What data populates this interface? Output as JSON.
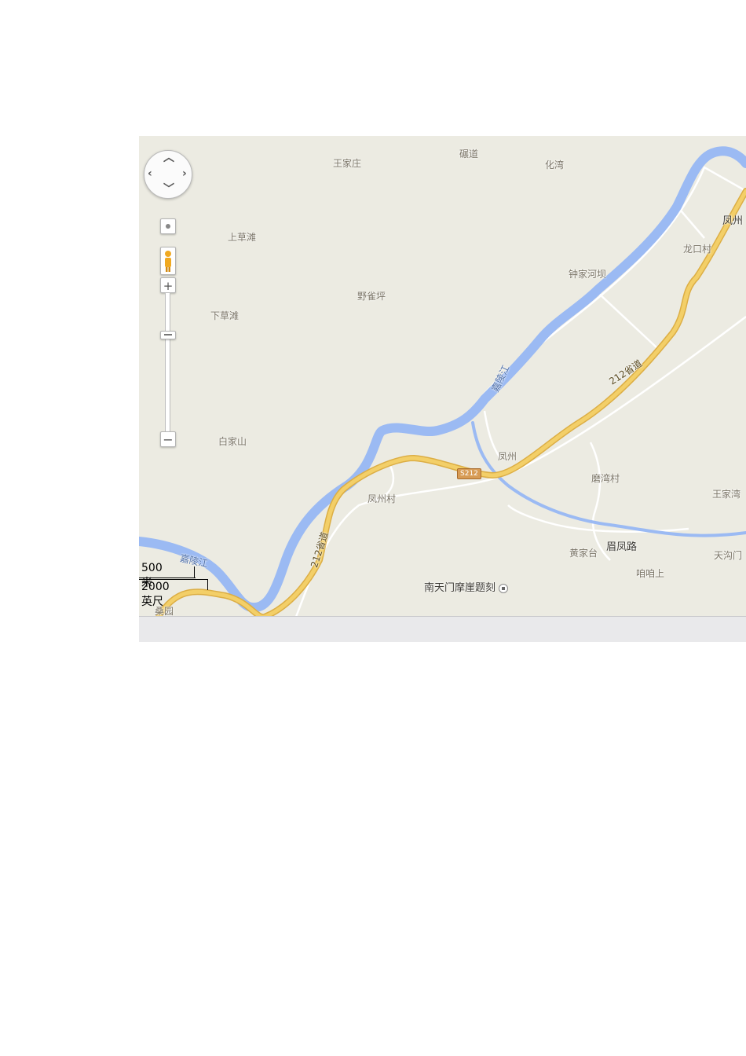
{
  "map": {
    "places": {
      "wangjiazhuang": "王家庄",
      "niandao": "碾道",
      "huawan": "化湾",
      "fengzhou_ne": "凤州",
      "longkoucun": "龙口村",
      "shangcaotan": "上草滩",
      "zhongjiaheba": "钟家河坝",
      "yequeping": "野雀坪",
      "xiacaotan": "下草滩",
      "baijiashan": "白家山",
      "fengzhou": "凤州",
      "mowancun": "磨湾村",
      "wangjiawan": "王家湾",
      "fengzhoucun": "凤州村",
      "huangjiatai": "黄家台",
      "meifenglu": "眉凤路",
      "tiangoumen": "天沟门",
      "zazashang": "咱咱上",
      "sangyuan": "桑园",
      "nantianmen": "南天门摩崖题刻"
    },
    "river_label_1": "嘉陵江",
    "river_label_2": "嘉陵江",
    "road_label_1": "212省道",
    "road_label_2": "212省道",
    "shield": "S212",
    "scale_metric": "500 米",
    "scale_imperial": "2000 英尺"
  },
  "colors": {
    "land": "#ecebe2",
    "water": "#9bbaf3",
    "highway": "#f3cf68",
    "highway_edge": "#dcae45",
    "minor_road": "#ffffff"
  },
  "icons": [
    "pan-up-icon",
    "pan-down-icon",
    "pan-left-icon",
    "pan-right-icon",
    "pegman-icon",
    "zoom-in-icon",
    "zoom-out-icon",
    "poi-icon"
  ]
}
